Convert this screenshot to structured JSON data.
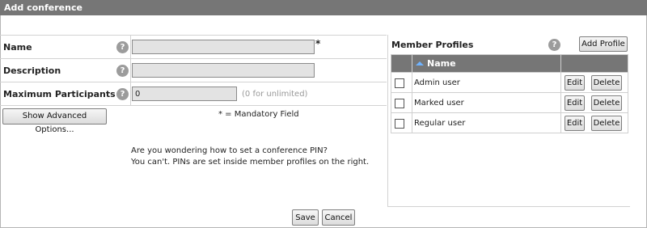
{
  "dialog": {
    "title": "Add conference"
  },
  "form": {
    "name_label": "Name",
    "description_label": "Description",
    "max_participants_label": "Maximum Participants",
    "help_glyph": "?",
    "name_value": "",
    "description_value": "",
    "max_participants_value": "0",
    "max_participants_hint": "(0 for unlimited)",
    "required_marker": "*",
    "advanced_button": "Show Advanced Options...",
    "mandatory_note": "* = Mandatory Field",
    "pin_question": "Are you wondering how to set a conference PIN?",
    "pin_answer": "You can't. PINs are set inside member profiles on the right."
  },
  "profiles": {
    "title": "Member Profiles",
    "add_button": "Add Profile",
    "column_name": "Name",
    "sort_icon": "sort-asc-icon",
    "edit_label": "Edit",
    "delete_label": "Delete",
    "rows": [
      {
        "name": "Admin user",
        "checked": false
      },
      {
        "name": "Marked user",
        "checked": false
      },
      {
        "name": "Regular user",
        "checked": false
      }
    ]
  },
  "footer": {
    "save": "Save",
    "cancel": "Cancel"
  },
  "colors": {
    "titlebar": "#767676",
    "sort_icon": "#6fb3ff",
    "field_bg": "#e3e3e3"
  }
}
